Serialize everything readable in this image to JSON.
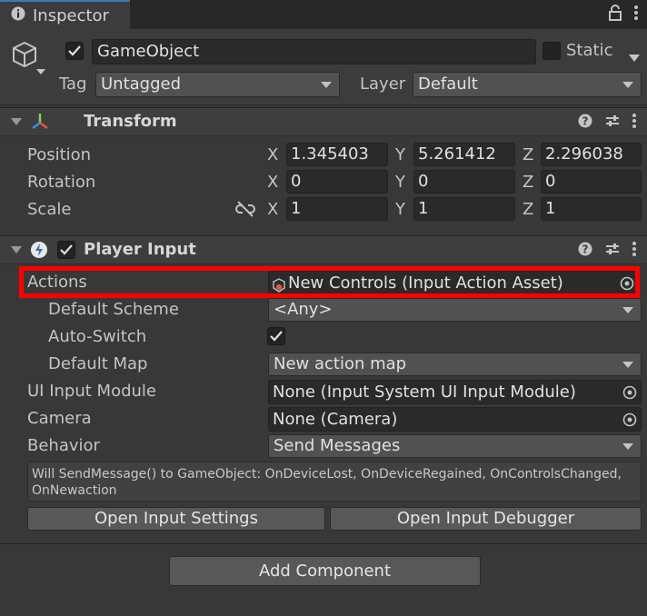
{
  "tab": {
    "title": "Inspector",
    "icon": "info-icon"
  },
  "header": {
    "object_name": "GameObject",
    "static_label": "Static",
    "tag_label": "Tag",
    "tag_value": "Untagged",
    "layer_label": "Layer",
    "layer_value": "Default"
  },
  "transform": {
    "title": "Transform",
    "rows": [
      {
        "label": "Position",
        "x": "1.345403",
        "y": "5.261412",
        "z": "2.296038"
      },
      {
        "label": "Rotation",
        "x": "0",
        "y": "0",
        "z": "0"
      },
      {
        "label": "Scale",
        "x": "1",
        "y": "1",
        "z": "1"
      }
    ],
    "axis": {
      "x": "X",
      "y": "Y",
      "z": "Z"
    }
  },
  "player_input": {
    "title": "Player Input",
    "actions_label": "Actions",
    "actions_value": "New Controls (Input Action Asset)",
    "default_scheme_label": "Default Scheme",
    "default_scheme_value": "<Any>",
    "auto_switch_label": "Auto-Switch",
    "default_map_label": "Default Map",
    "default_map_value": "New action map",
    "ui_input_module_label": "UI Input Module",
    "ui_input_module_value": "None (Input System UI Input Module)",
    "camera_label": "Camera",
    "camera_value": "None (Camera)",
    "behavior_label": "Behavior",
    "behavior_value": "Send Messages",
    "help_text": "Will SendMessage() to GameObject: OnDeviceLost, OnDeviceRegained, OnControlsChanged, OnNewaction",
    "open_settings_label": "Open Input Settings",
    "open_debugger_label": "Open Input Debugger"
  },
  "add_component_label": "Add Component",
  "colors": {
    "highlight": "#ff0000",
    "tab_accent": "#3a79bb",
    "background": "#383838"
  }
}
